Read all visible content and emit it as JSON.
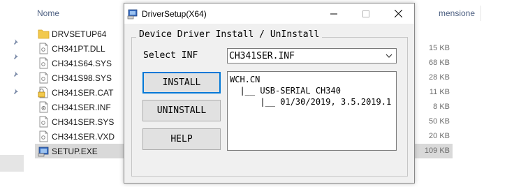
{
  "explorer": {
    "column_name": "Nome",
    "column_size": "mensione",
    "files": [
      {
        "name": "DRVSETUP64",
        "size": "",
        "icon": "folder-icon"
      },
      {
        "name": "CH341PT.DLL",
        "size": "15 KB",
        "icon": "file-icon"
      },
      {
        "name": "CH341S64.SYS",
        "size": "68 KB",
        "icon": "file-icon"
      },
      {
        "name": "CH341S98.SYS",
        "size": "28 KB",
        "icon": "file-icon"
      },
      {
        "name": "CH341SER.CAT",
        "size": "11 KB",
        "icon": "security-catalog-icon"
      },
      {
        "name": "CH341SER.INF",
        "size": "8 KB",
        "icon": "setup-info-icon"
      },
      {
        "name": "CH341SER.SYS",
        "size": "50 KB",
        "icon": "file-icon"
      },
      {
        "name": "CH341SER.VXD",
        "size": "20 KB",
        "icon": "file-icon"
      },
      {
        "name": "SETUP.EXE",
        "size": "109 KB",
        "icon": "setup-exe-icon"
      }
    ]
  },
  "dialog": {
    "title": "DriverSetup(X64)",
    "group_label": "Device Driver Install / UnInstall",
    "select_label": "Select INF",
    "select_value": "CH341SER.INF",
    "buttons": {
      "install": "INSTALL",
      "uninstall": "UNINSTALL",
      "help": "HELP"
    },
    "info_lines": [
      "WCH.CN",
      "  |__ USB-SERIAL CH340",
      "      |__ 01/30/2019, 3.5.2019.1"
    ]
  },
  "colors": {
    "accent": "#0078d7",
    "dialog_bg": "#f0f0f0",
    "selection": "#d9d9d9"
  }
}
